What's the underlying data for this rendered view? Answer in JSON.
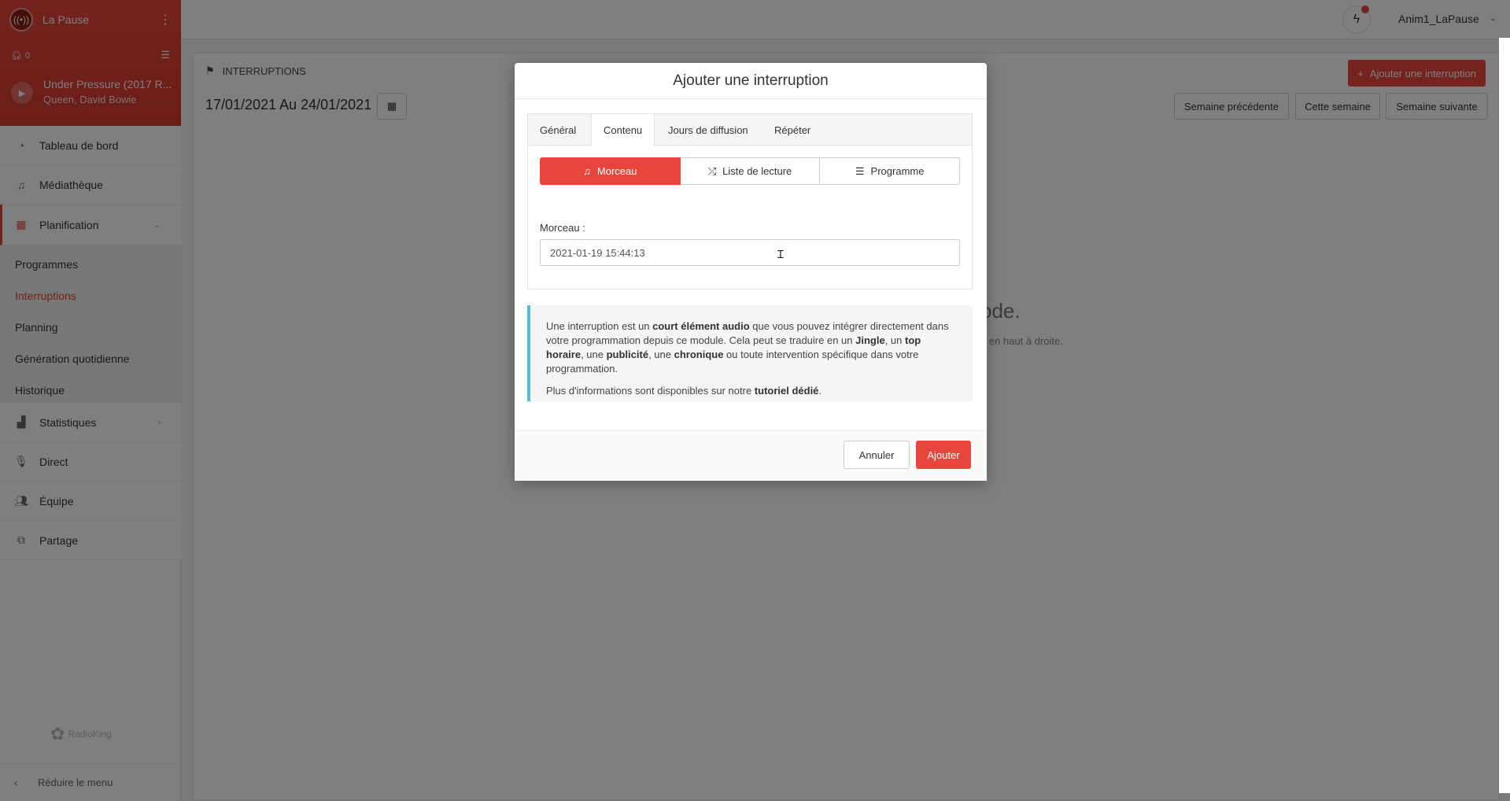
{
  "sidebar": {
    "radio_name": "La Pause",
    "listeners": "0",
    "track_title": "Under Pressure (2017 R...",
    "track_artist": "Queen, David Bowie",
    "nav": {
      "dashboard": "Tableau de bord",
      "library": "Médiathèque",
      "planning": "Planification",
      "stats": "Statistiques",
      "live": "Direct",
      "team": "Équipe",
      "share": "Partage"
    },
    "subnav": {
      "programmes": "Programmes",
      "interruptions": "Interruptions",
      "planning": "Planning",
      "generation": "Génération quotidienne",
      "history": "Historique"
    },
    "brand": "RadioKing",
    "reduce": "Réduire le menu"
  },
  "topbar": {
    "user": "Anim1_LaPause"
  },
  "page": {
    "section": "INTERRUPTIONS",
    "date_range": "17/01/2021 Au 24/01/2021",
    "add_button": "Ajouter une interruption",
    "prev_week": "Semaine précédente",
    "this_week": "Cette semaine",
    "next_week": "Semaine suivante",
    "empty_title_fragment": "ode.",
    "empty_hint_fragment": "n en haut à droite."
  },
  "modal": {
    "title": "Ajouter une interruption",
    "tabs": [
      "Général",
      "Contenu",
      "Jours de diffusion",
      "Répéter"
    ],
    "active_tab": "Contenu",
    "segments": [
      "Morceau",
      "Liste de lecture",
      "Programme"
    ],
    "active_segment": "Morceau",
    "field_label": "Morceau :",
    "field_value": "2021-01-19 15:44:13",
    "info": {
      "p1_a": "Une interruption est un ",
      "p1_b": "court élément audio",
      "p1_c": " que vous pouvez intégrer directement dans votre programmation depuis ce module. Cela peut se traduire en un ",
      "p1_d": "Jingle",
      "p1_e": ", un ",
      "p1_f": "top horaire",
      "p1_g": ", une ",
      "p1_h": "publicité",
      "p1_i": ", une ",
      "p1_j": "chronique",
      "p1_k": " ou toute intervention spécifique dans votre programmation.",
      "p2_a": "Plus d'informations sont disponibles sur notre ",
      "p2_b": "tutoriel dédié",
      "p2_c": "."
    },
    "cancel": "Annuler",
    "submit": "Ajouter"
  },
  "colors": {
    "accent": "#e8463c",
    "info_border": "#5bb9d8"
  }
}
